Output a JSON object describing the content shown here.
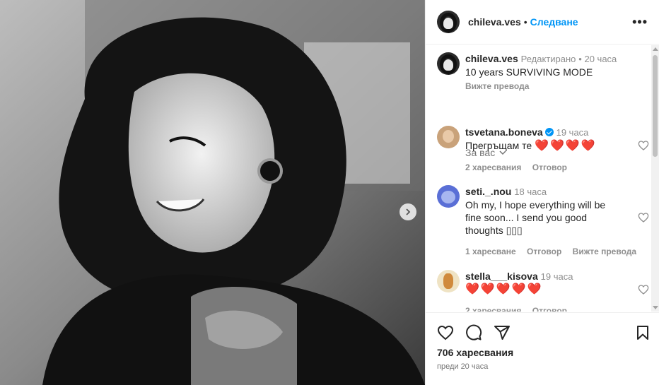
{
  "post": {
    "username": "chileva.ves",
    "follow_label": "Следване",
    "more_label": "•••",
    "caption": {
      "username": "chileva.ves",
      "edited": "Редактирано",
      "time": "20 часа",
      "text": "10 years SURVIVING MODE",
      "see_translation": "Вижте превода"
    },
    "for_you": "За вас"
  },
  "comments": [
    {
      "username": "tsvetana.boneva",
      "verified": true,
      "time": "19 часа",
      "text": "Прегръщам те",
      "hearts": "❤️❤️❤️❤️",
      "likes": "2 харесвания",
      "reply": "Отговор"
    },
    {
      "username": "seti._.nou",
      "time": "18 часа",
      "text_line1": "Oh my, I hope everything will be",
      "text_line2": "fine soon... I send you good",
      "text_line3": "thoughts ▯▯▯",
      "likes": "1 харесване",
      "reply": "Отговор",
      "see_translation": "Вижте превода"
    },
    {
      "username": "stella___kisova",
      "time": "19 часа",
      "hearts": "❤️❤️❤️❤️❤️",
      "likes": "2 харесвания",
      "reply": "Отговор"
    }
  ],
  "footer": {
    "likes": "706 харесвания",
    "ago": "преди 20 часа",
    "icons": [
      "heart-icon",
      "comment-icon",
      "share-icon",
      "bookmark-icon"
    ]
  },
  "colors": {
    "accent": "#0095f6",
    "heart": "#e0245e",
    "muted": "#8e8e8e"
  }
}
